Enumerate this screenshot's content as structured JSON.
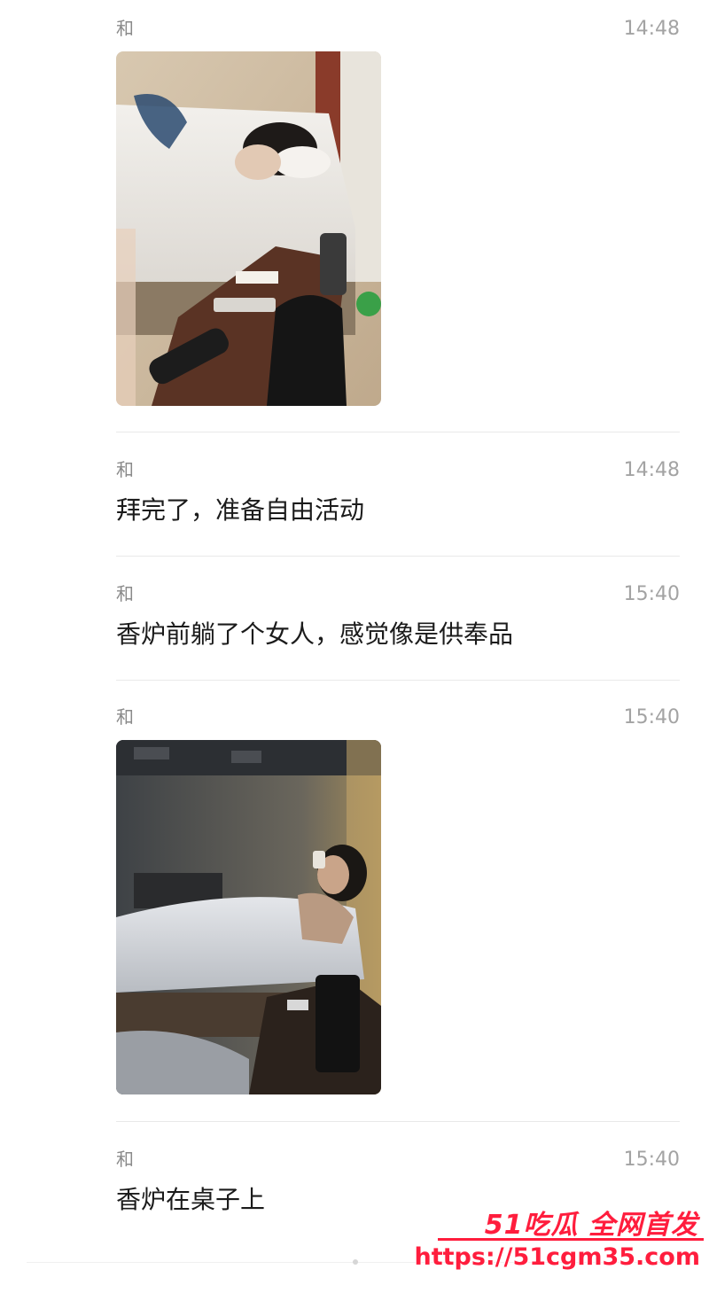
{
  "messages": [
    {
      "sender": "和",
      "time": "14:48",
      "type": "image",
      "image_desc": "bedroom-photo-1"
    },
    {
      "sender": "和",
      "time": "14:48",
      "type": "text",
      "text": "拜完了，准备自由活动"
    },
    {
      "sender": "和",
      "time": "15:40",
      "type": "text",
      "text": "香炉前躺了个女人，感觉像是供奉品"
    },
    {
      "sender": "和",
      "time": "15:40",
      "type": "image",
      "image_desc": "bedroom-photo-2"
    },
    {
      "sender": "和",
      "time": "15:40",
      "type": "text",
      "text": "香炉在桌子上"
    }
  ],
  "watermark": {
    "title": "51吃瓜 全网首发",
    "url": "https://51cgm35.com"
  },
  "colors": {
    "watermark": "#ff1d3d",
    "divider": "#e9e9e9",
    "meta_text": "#8a8a8a"
  }
}
